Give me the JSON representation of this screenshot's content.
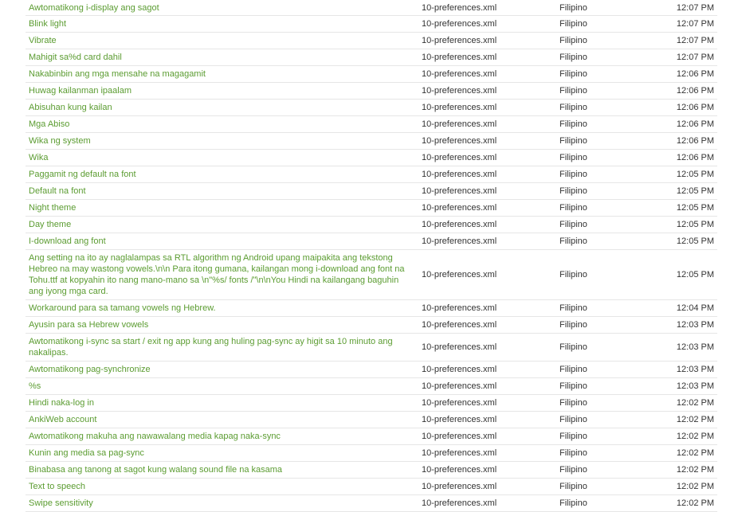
{
  "colors": {
    "link": "#5b9c31",
    "text": "#333333",
    "row_border": "#e6e6e6"
  },
  "rows": [
    {
      "string": "Awtomatikong i-display ang sagot",
      "file": "10-preferences.xml",
      "language": "Filipino",
      "time": "12:07 PM"
    },
    {
      "string": "Blink light",
      "file": "10-preferences.xml",
      "language": "Filipino",
      "time": "12:07 PM"
    },
    {
      "string": "Vibrate",
      "file": "10-preferences.xml",
      "language": "Filipino",
      "time": "12:07 PM"
    },
    {
      "string": "Mahigit sa%d card dahil",
      "file": "10-preferences.xml",
      "language": "Filipino",
      "time": "12:07 PM"
    },
    {
      "string": "Nakabinbin ang mga mensahe na magagamit",
      "file": "10-preferences.xml",
      "language": "Filipino",
      "time": "12:06 PM"
    },
    {
      "string": "Huwag kailanman ipaalam",
      "file": "10-preferences.xml",
      "language": "Filipino",
      "time": "12:06 PM"
    },
    {
      "string": "Abisuhan kung kailan",
      "file": "10-preferences.xml",
      "language": "Filipino",
      "time": "12:06 PM"
    },
    {
      "string": "Mga Abiso",
      "file": "10-preferences.xml",
      "language": "Filipino",
      "time": "12:06 PM"
    },
    {
      "string": "Wika ng system",
      "file": "10-preferences.xml",
      "language": "Filipino",
      "time": "12:06 PM"
    },
    {
      "string": "Wika",
      "file": "10-preferences.xml",
      "language": "Filipino",
      "time": "12:06 PM"
    },
    {
      "string": "Paggamit ng default na font",
      "file": "10-preferences.xml",
      "language": "Filipino",
      "time": "12:05 PM"
    },
    {
      "string": "Default na font",
      "file": "10-preferences.xml",
      "language": "Filipino",
      "time": "12:05 PM"
    },
    {
      "string": "Night theme",
      "file": "10-preferences.xml",
      "language": "Filipino",
      "time": "12:05 PM"
    },
    {
      "string": "Day theme",
      "file": "10-preferences.xml",
      "language": "Filipino",
      "time": "12:05 PM"
    },
    {
      "string": "I-download ang font",
      "file": "10-preferences.xml",
      "language": "Filipino",
      "time": "12:05 PM"
    },
    {
      "string": "Ang setting na ito ay naglalampas sa RTL algorithm ng Android upang maipakita ang tekstong Hebreo na may wastong vowels.\\n\\n Para itong gumana, kailangan mong i-download ang font na Tohu.ttf at kopyahin ito nang mano-mano sa \\n\"%s/ fonts /\"\\n\\nYou Hindi na kailangang baguhin ang iyong mga card.",
      "file": "10-preferences.xml",
      "language": "Filipino",
      "time": "12:05 PM"
    },
    {
      "string": "Workaround para sa tamang vowels ng Hebrew.",
      "file": "10-preferences.xml",
      "language": "Filipino",
      "time": "12:04 PM"
    },
    {
      "string": "Ayusin para sa Hebrew vowels",
      "file": "10-preferences.xml",
      "language": "Filipino",
      "time": "12:03 PM"
    },
    {
      "string": "Awtomatikong i-sync sa start / exit ng app kung ang huling pag-sync ay higit sa 10          minuto ang nakalipas.",
      "file": "10-preferences.xml",
      "language": "Filipino",
      "time": "12:03 PM"
    },
    {
      "string": "Awtomatikong pag-synchronize",
      "file": "10-preferences.xml",
      "language": "Filipino",
      "time": "12:03 PM"
    },
    {
      "string": "%s",
      "file": "10-preferences.xml",
      "language": "Filipino",
      "time": "12:03 PM"
    },
    {
      "string": "Hindi naka-log in",
      "file": "10-preferences.xml",
      "language": "Filipino",
      "time": "12:02 PM"
    },
    {
      "string": "AnkiWeb account",
      "file": "10-preferences.xml",
      "language": "Filipino",
      "time": "12:02 PM"
    },
    {
      "string": "Awtomatikong makuha ang nawawalang media kapag naka-sync",
      "file": "10-preferences.xml",
      "language": "Filipino",
      "time": "12:02 PM"
    },
    {
      "string": "Kunin ang media sa pag-sync",
      "file": "10-preferences.xml",
      "language": "Filipino",
      "time": "12:02 PM"
    },
    {
      "string": "Binabasa ang tanong at sagot kung walang sound file na kasama",
      "file": "10-preferences.xml",
      "language": "Filipino",
      "time": "12:02 PM"
    },
    {
      "string": "Text to speech",
      "file": "10-preferences.xml",
      "language": "Filipino",
      "time": "12:02 PM"
    },
    {
      "string": "Swipe sensitivity",
      "file": "10-preferences.xml",
      "language": "Filipino",
      "time": "12:02 PM"
    }
  ]
}
